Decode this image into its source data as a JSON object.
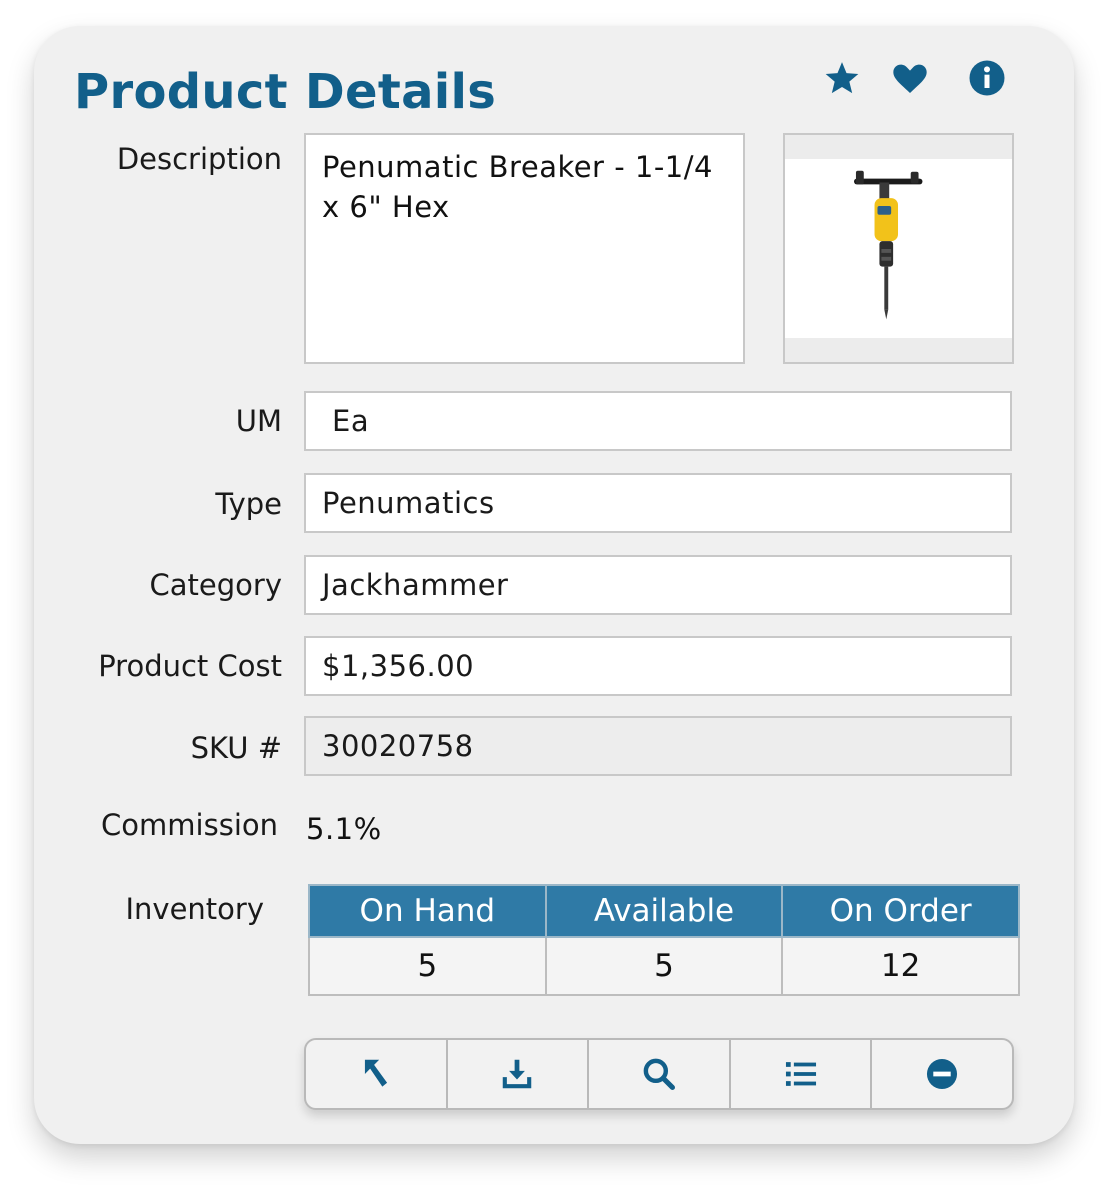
{
  "header": {
    "title": "Product Details",
    "icons": [
      "star-icon",
      "heart-icon",
      "info-icon"
    ],
    "accent_color": "#125f8a"
  },
  "fields": {
    "description_label": "Description",
    "description_value": "Penumatic Breaker - 1-1/4 x 6\" Hex",
    "um_label": "UM",
    "um_value": "Ea",
    "type_label": "Type",
    "type_value": "Penumatics",
    "category_label": "Category",
    "category_value": "Jackhammer",
    "cost_label": "Product Cost",
    "cost_value": "$1,356.00",
    "sku_label": "SKU #",
    "sku_value": "30020758",
    "commission_label": "Commission",
    "commission_value": "5.1%"
  },
  "product_image": {
    "icon": "jackhammer-image"
  },
  "inventory": {
    "label": "Inventory",
    "headers": [
      "On  Hand",
      "Available",
      "On Order"
    ],
    "values": [
      "5",
      "5",
      "12"
    ],
    "header_color": "#2f7aa6"
  },
  "toolbar": {
    "buttons": [
      "back-arrow-icon",
      "download-icon",
      "search-icon",
      "list-icon",
      "remove-icon"
    ]
  }
}
